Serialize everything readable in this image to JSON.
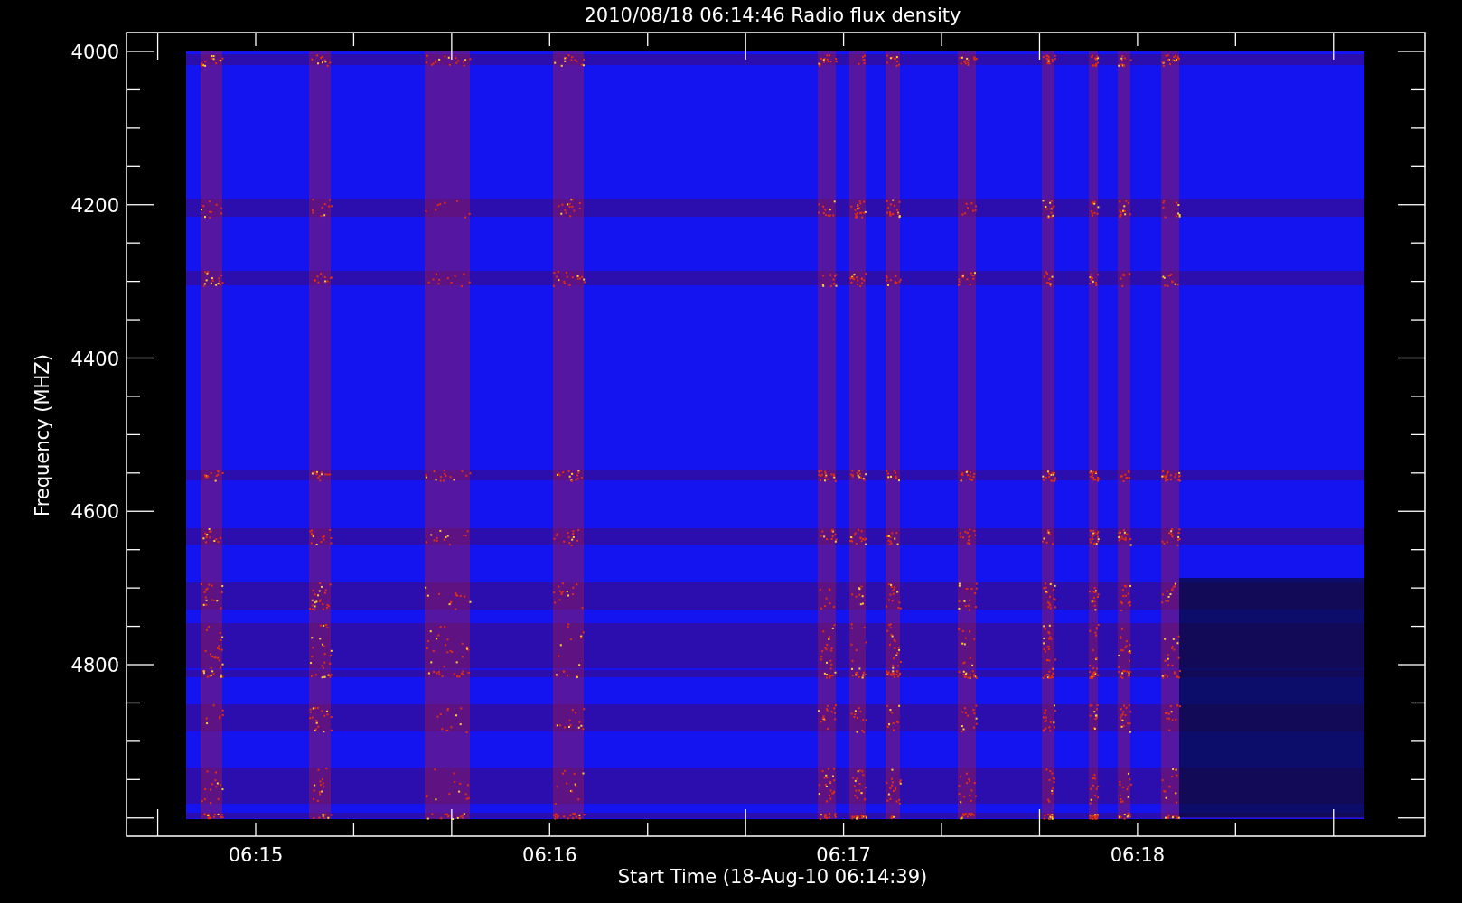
{
  "title": "2010/08/18 06:14:46 Radio flux density",
  "y_axis": {
    "label": "Frequency (MHZ)",
    "ticks": [
      "4000",
      "4200",
      "4400",
      "4600",
      "4800"
    ]
  },
  "x_axis": {
    "label": "Start Time (18-Aug-10 06:14:39)",
    "ticks": [
      "06:15",
      "06:16",
      "06:17",
      "06:18"
    ]
  }
}
